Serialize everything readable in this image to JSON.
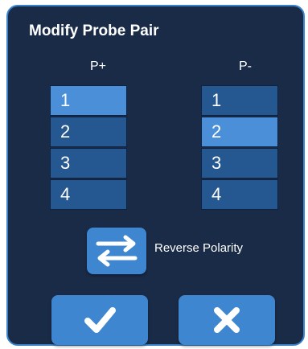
{
  "dialog": {
    "title": "Modify Probe Pair",
    "left_column": {
      "label": "P+",
      "items": [
        "1",
        "2",
        "3",
        "4"
      ],
      "selected": "1"
    },
    "right_column": {
      "label": "P-",
      "items": [
        "1",
        "2",
        "3",
        "4"
      ],
      "selected": "2"
    },
    "reverse_polarity": {
      "label": "Reverse Polarity",
      "icon": "swap-arrows-icon"
    },
    "confirm_icon": "checkmark-icon",
    "cancel_icon": "close-icon"
  },
  "colors": {
    "background": "#1a2b47",
    "item": "#255791",
    "item_selected": "#4a8fd8",
    "button": "#3f86d0",
    "border": "#3a82c9"
  }
}
